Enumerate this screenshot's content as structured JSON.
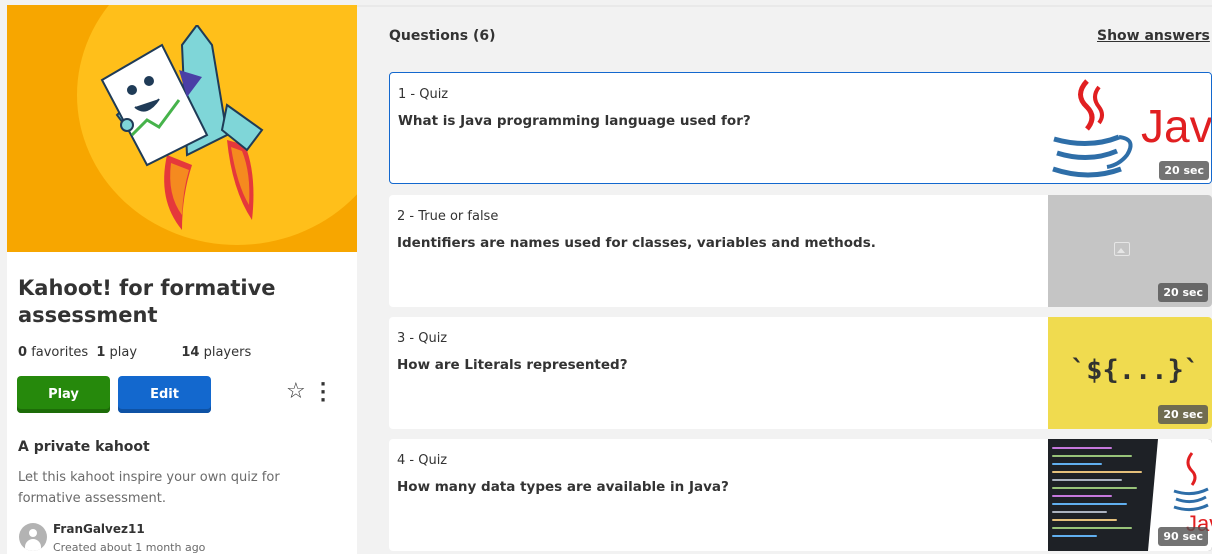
{
  "kahoot": {
    "title": "Kahoot! for formative assessment",
    "favorites_count": "0",
    "favorites_label": "favorites",
    "plays_count": "1",
    "plays_label": "play",
    "players_count": "14",
    "players_label": "players",
    "play_label": "Play",
    "edit_label": "Edit",
    "visibility": "A private kahoot",
    "description": "Let this kahoot inspire your own quiz for formative assessment.",
    "author": "FranGalvez11",
    "created": "Created about 1 month ago"
  },
  "questions_header": "Questions (6)",
  "show_answers_label": "Show answers",
  "questions": [
    {
      "type": "1 - Quiz",
      "text": "What is Java programming language used for?",
      "time": "20 sec",
      "image": "java-logo-icon"
    },
    {
      "type": "2 - True or false",
      "text": "Identifiers are names used for classes, variables and methods.",
      "time": "20 sec",
      "image": "image-placeholder-icon"
    },
    {
      "type": "3 - Quiz",
      "text": "How are Literals represented?",
      "time": "20 sec",
      "image_text": "`${...}`"
    },
    {
      "type": "4 - Quiz",
      "text": "How many data types are available in Java?",
      "time": "90 sec",
      "image": "java-code-image"
    }
  ],
  "colors": {
    "play": "#26890c",
    "edit": "#1368ce",
    "cover_bg": "#f7a600",
    "active_border": "#1368ce"
  },
  "java_word": "Java",
  "java_word_small": "Java"
}
